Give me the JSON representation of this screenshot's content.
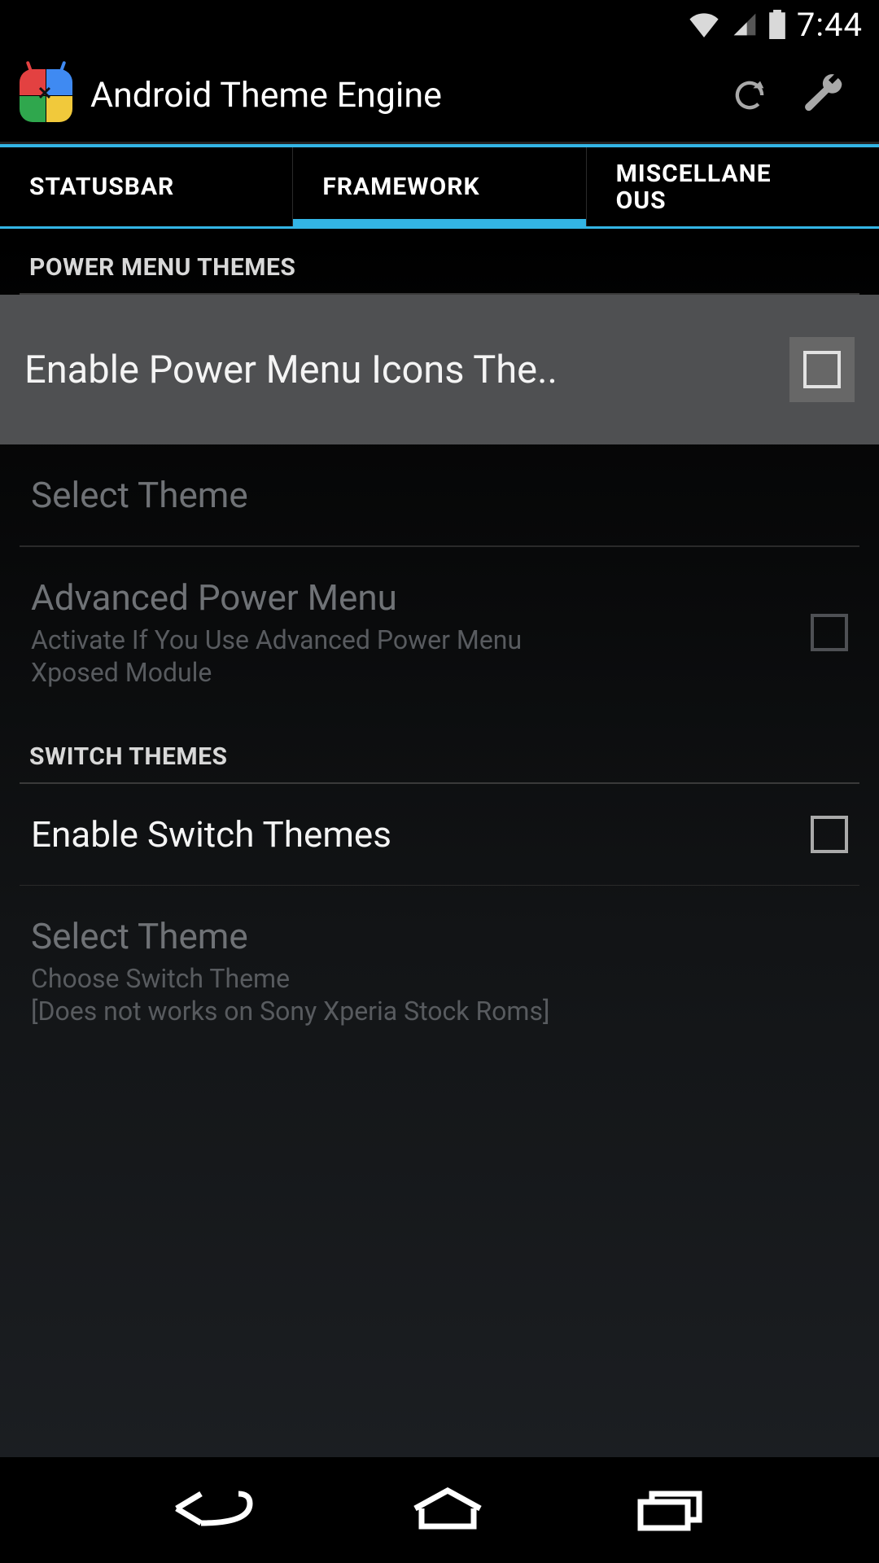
{
  "status": {
    "time": "7:44"
  },
  "action_bar": {
    "title": "Android Theme Engine"
  },
  "tabs": [
    {
      "label": "STATUSBAR",
      "active": false
    },
    {
      "label": "FRAMEWORK",
      "active": true
    },
    {
      "label": "MISCELLANEOUS",
      "active": false
    }
  ],
  "sections": {
    "power_menu": {
      "header": "POWER MENU THEMES",
      "enable": {
        "title": "Enable Power Menu Icons The.."
      },
      "select": {
        "title": "Select Theme"
      },
      "advanced": {
        "title": "Advanced Power Menu",
        "summary": "Activate If You Use Advanced Power Menu Xposed Module"
      }
    },
    "switch": {
      "header": "SWITCH THEMES",
      "enable": {
        "title": "Enable Switch Themes"
      },
      "select": {
        "title": "Select Theme",
        "summary": "Choose Switch Theme\n[Does not works on Sony Xperia Stock Roms]"
      }
    }
  }
}
